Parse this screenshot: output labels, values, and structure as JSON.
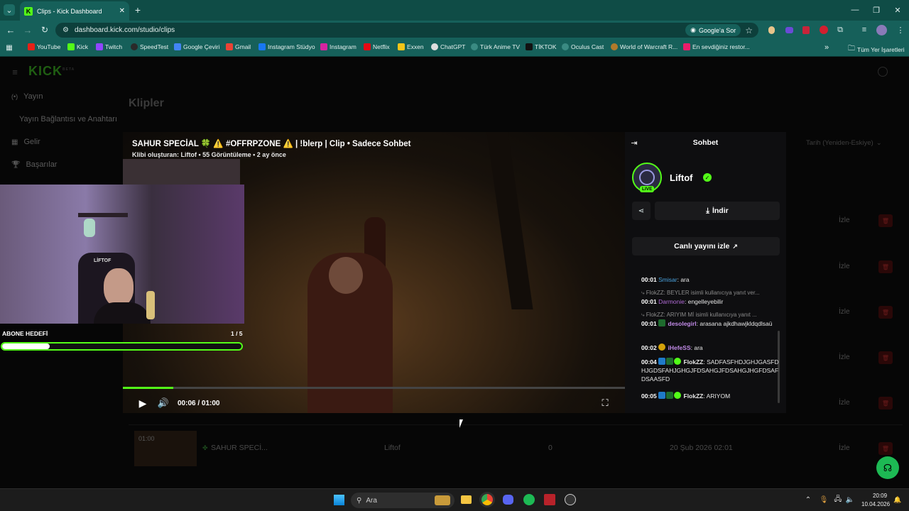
{
  "browser": {
    "tab_title": "Clips - Kick Dashboard",
    "url": "dashboard.kick.com/studio/clips",
    "google_lens": "Google'a Sor",
    "bookmarks": [
      "YouTube",
      "Kick",
      "Twitch",
      "SpeedTest",
      "Google Çeviri",
      "Gmail",
      "Instagram Stüdyo",
      "Instagram",
      "Netflix",
      "Exxen",
      "ChatGPT",
      "Türk Anime TV",
      "TİKTOK",
      "Oculus Cast",
      "World of Warcraft R...",
      "En sevdiğiniz restor..."
    ],
    "all_bookmarks": "Tüm Yer İşaretleri"
  },
  "app": {
    "logo": "KICK",
    "logo_sup": "BETA",
    "nav": [
      {
        "icon": "(•)",
        "label": "Yayın"
      },
      {
        "label": "Yayın Bağlantısı ve Anahtarı"
      },
      {
        "icon": "▦",
        "label": "Gelir"
      },
      {
        "icon": "🏆",
        "label": "Başarılar"
      }
    ],
    "page_title": "Klipler",
    "sort_label": "Tarih (Yeniden-Eskiye)",
    "watch_label": "İzle",
    "bottom_row": {
      "duration": "01:00",
      "title": "SAHUR SPECİ...",
      "creator": "Liftof",
      "views": "0",
      "date": "20 Şub 2026 02:01"
    }
  },
  "clip": {
    "title": "SAHUR SPECİAL 🍀 ⚠️ #OFFRPZONE ⚠️ | !blerp | Clip • Sadece Sohbet",
    "meta": "Klibi oluşturan: Liftof • 55 Görüntüleme • 2 ay önce",
    "time": "00:06 / 01:00",
    "progress_fraction": 0.1,
    "overlay_goal_label": "ABONE HEDEFİ",
    "overlay_goal_count": "1 / 5",
    "overlay_goal_fraction": 0.2,
    "cam_logo": "LİFTOF"
  },
  "chat": {
    "header": "Sohbet",
    "channel": "Liftof",
    "live_badge": "LIVE",
    "download": "İndir",
    "watch_live": "Canlı yayını izle",
    "messages": [
      {
        "time": "00:01",
        "user": "Smisar",
        "color": "#4aa3df",
        "text": "ara"
      },
      {
        "reply": "FlokZZ: BEYLER isimli kullanıcıya yanıt ver..."
      },
      {
        "time": "00:01",
        "user": "Darmonie",
        "color": "#b26bd6",
        "text": "engelleyebilir"
      },
      {
        "reply": "FlokZZ: ARIYIM Mİ isimli kullanıcıya yanıt ..."
      },
      {
        "time": "00:01",
        "user": "desolegirl",
        "color": "#c08ae6",
        "text": "arasana ajkdhawjkldqdlsaü"
      },
      {
        "time": "00:02",
        "user": "iHefeSS",
        "color": "#c08ae6",
        "text": "ara"
      },
      {
        "time": "00:04",
        "user": "FlokZZ",
        "color": "#e6e6e6",
        "text": "SADFASFHDJGHJGASFDHJGDSFAHJGHGJFDSAHGJFDSAHGJHGFDSAFDSAASFD"
      },
      {
        "time": "00:05",
        "user": "FlokZZ",
        "color": "#e6e6e6",
        "text": "ARIYOM"
      }
    ]
  },
  "taskbar": {
    "search": "Ara",
    "time": "20:09",
    "date": "10.04.2026"
  },
  "colors": {
    "kick_green": "#53fc18",
    "chrome_teal": "#16605a",
    "delete_red": "#6b1b1b"
  }
}
